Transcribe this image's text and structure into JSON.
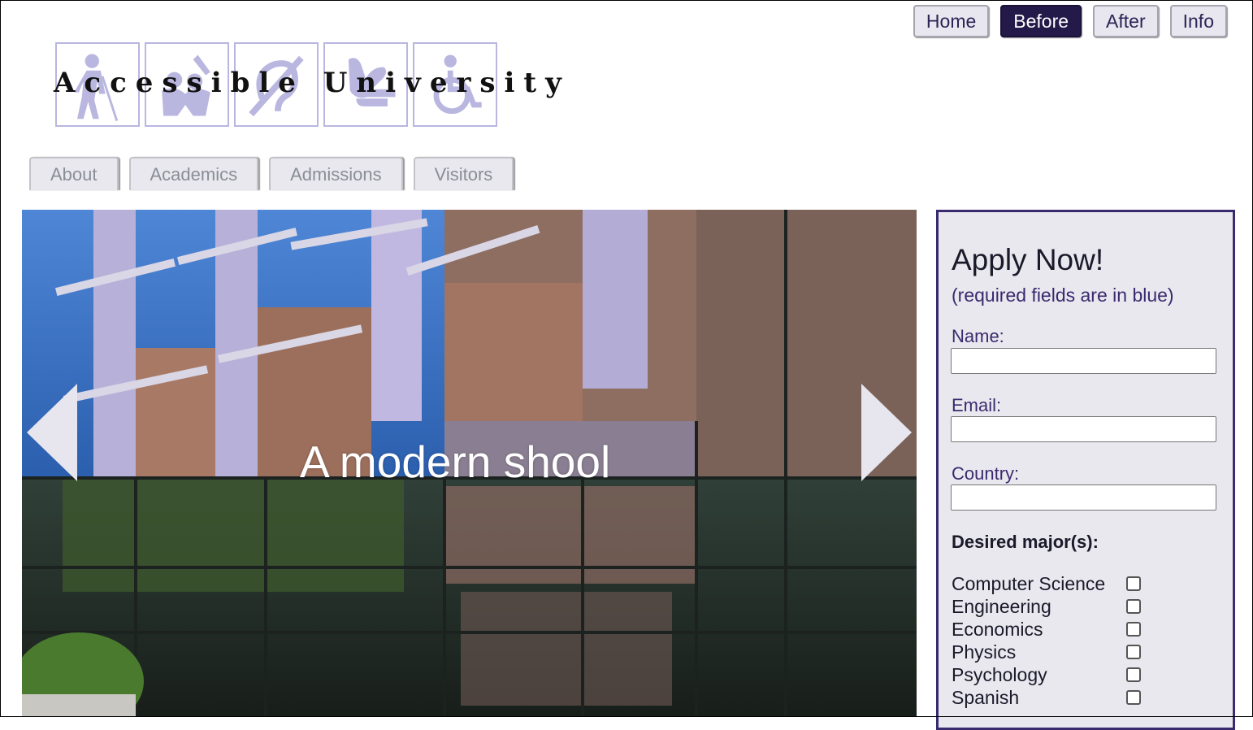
{
  "top_nav": {
    "items": [
      {
        "label": "Home",
        "active": false
      },
      {
        "label": "Before",
        "active": true
      },
      {
        "label": "After",
        "active": false
      },
      {
        "label": "Info",
        "active": false
      }
    ]
  },
  "logo": {
    "text": "Accessible University"
  },
  "tabs": [
    {
      "label": "About"
    },
    {
      "label": "Academics"
    },
    {
      "label": "Admissions"
    },
    {
      "label": "Visitors"
    }
  ],
  "carousel": {
    "caption": "A modern shool",
    "prev_icon": "left-arrow-icon",
    "next_icon": "right-arrow-icon"
  },
  "apply_form": {
    "title": "Apply Now!",
    "note": "(required fields are in blue)",
    "fields": [
      {
        "label": "Name:",
        "value": ""
      },
      {
        "label": "Email:",
        "value": ""
      },
      {
        "label": "Country:",
        "value": ""
      }
    ],
    "majors_title": "Desired major(s):",
    "majors": [
      {
        "label": "Computer Science",
        "checked": false
      },
      {
        "label": "Engineering",
        "checked": false
      },
      {
        "label": "Economics",
        "checked": false
      },
      {
        "label": "Physics",
        "checked": false
      },
      {
        "label": "Psychology",
        "checked": false
      },
      {
        "label": "Spanish",
        "checked": false
      }
    ]
  },
  "colors": {
    "active_nav": "#241a4a",
    "form_border": "#3a2a6e",
    "label_blue": "#3a2a6e",
    "tab_bg": "#e9e8ee"
  }
}
